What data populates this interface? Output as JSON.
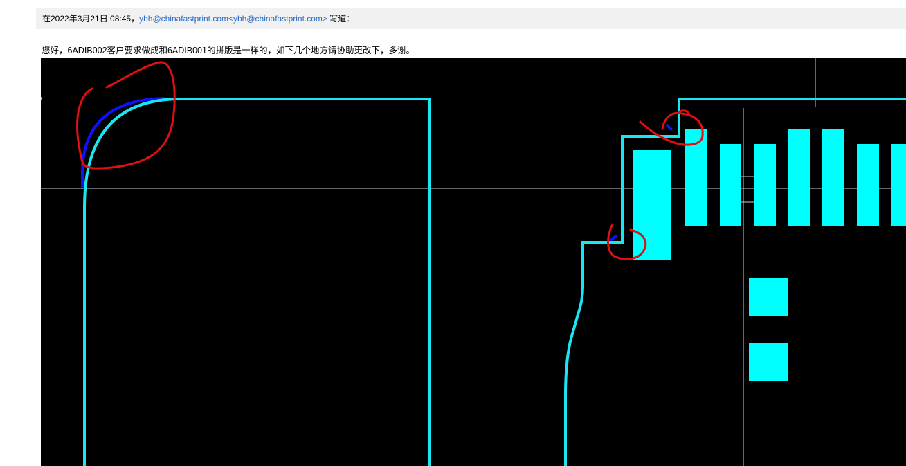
{
  "quote_header": {
    "date_prefix": "在2022年3月21日 08:45，",
    "sender_link": "ybh@chinafastprint.com<ybh@chinafastprint.com>",
    "suffix": " 写道："
  },
  "message": {
    "body_text": "您好，6ADIB002客户要求做成和6ADIB001的拼版是一样的，如下几个地方请协助更改下，多谢。"
  },
  "image": {
    "colors": {
      "background": "#000000",
      "outline": "#19e6f0",
      "pad": "#00ffff",
      "original_outline": "#1010ff",
      "annotation": "#e01010",
      "crosshair": "#c8c8c8"
    }
  }
}
